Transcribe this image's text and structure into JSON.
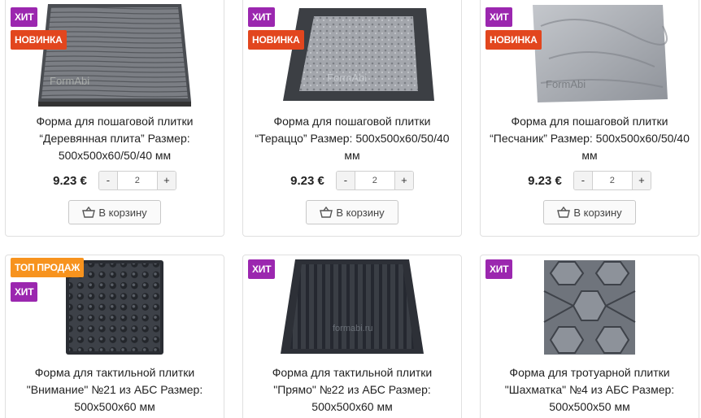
{
  "currency_price_qty": {
    "price": "9.23 €",
    "minus": "-",
    "plus": "+",
    "qty": "2"
  },
  "cart_label": "В корзину",
  "products": [
    {
      "title": "Форма для пошаговой плитки “Деревянная плита” Размер: 500x500x60/50/40 мм",
      "badges": [
        "ХИТ",
        "НОВИНКА"
      ],
      "watermark": "FormAbi"
    },
    {
      "title": "Форма для пошаговой плитки “Тераццо” Размер: 500x500x60/50/40 мм",
      "badges": [
        "ХИТ",
        "НОВИНКА"
      ],
      "watermark": "FormAbi"
    },
    {
      "title": "Форма для пошаговой плитки “Песчаник” Размер: 500x500x60/50/40 мм",
      "badges": [
        "ХИТ",
        "НОВИНКА"
      ],
      "watermark": "FormAbi"
    },
    {
      "title": "Форма для тактильной плитки \"Внимание\" №21 из АБС Размер: 500x500x60 мм",
      "badges": [
        "ТОП ПРОДАЖ",
        "ХИТ"
      ]
    },
    {
      "title": "Форма для тактильной плитки \"Прямо\" №22 из АБС Размер: 500x500x60 мм",
      "badges": [
        "ХИТ"
      ],
      "watermark": "formabi.ru"
    },
    {
      "title": "Форма для тротуарной плитки \"Шахматка\" №4 из АБС Размер: 500x500x50 мм",
      "badges": [
        "ХИТ"
      ]
    }
  ],
  "colors": {
    "hit": "#9b27af",
    "new": "#e2461e",
    "top": "#f7931e"
  }
}
